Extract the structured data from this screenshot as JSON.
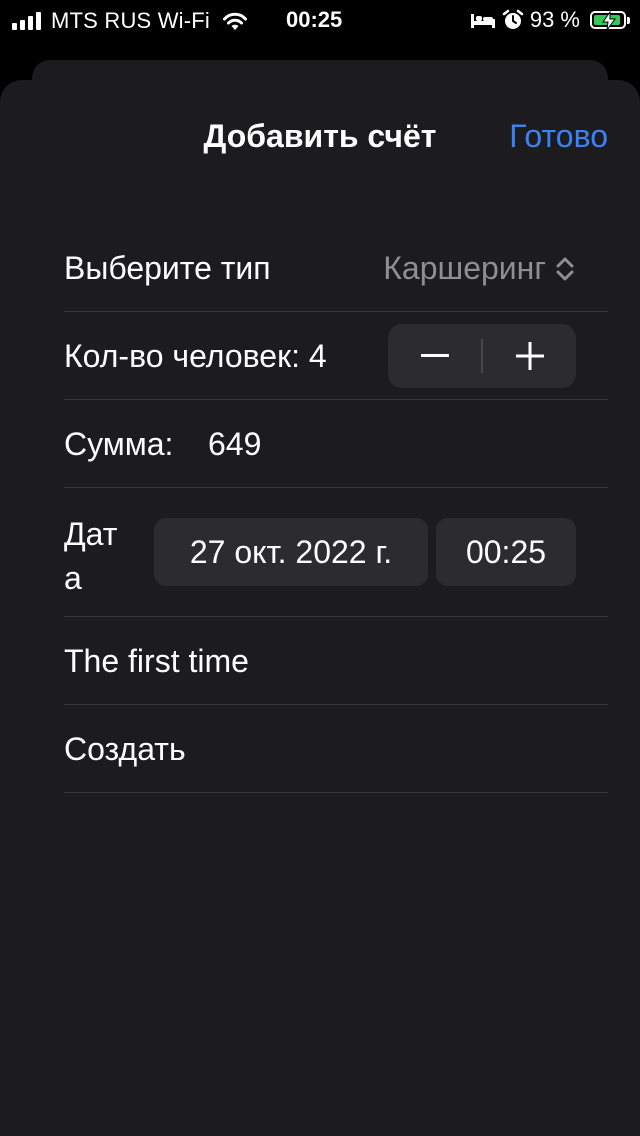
{
  "status_bar": {
    "carrier": "MTS RUS Wi-Fi",
    "time": "00:25",
    "battery_percent": "93 %",
    "battery_level": 0.93,
    "battery_color": "#34c759"
  },
  "sheet": {
    "title": "Добавить счёт",
    "done_label": "Готово",
    "accent_color": "#3b82f6"
  },
  "form": {
    "type_label": "Выберите тип",
    "type_value": "Каршеринг",
    "people_label": "Кол-во человек: 4",
    "sum_label": "Сумма:",
    "sum_value": "649",
    "date_label": "Дата",
    "date_value": "27 окт. 2022 г.",
    "time_value": "00:25",
    "note_row": "The first time",
    "create_row": "Создать"
  }
}
